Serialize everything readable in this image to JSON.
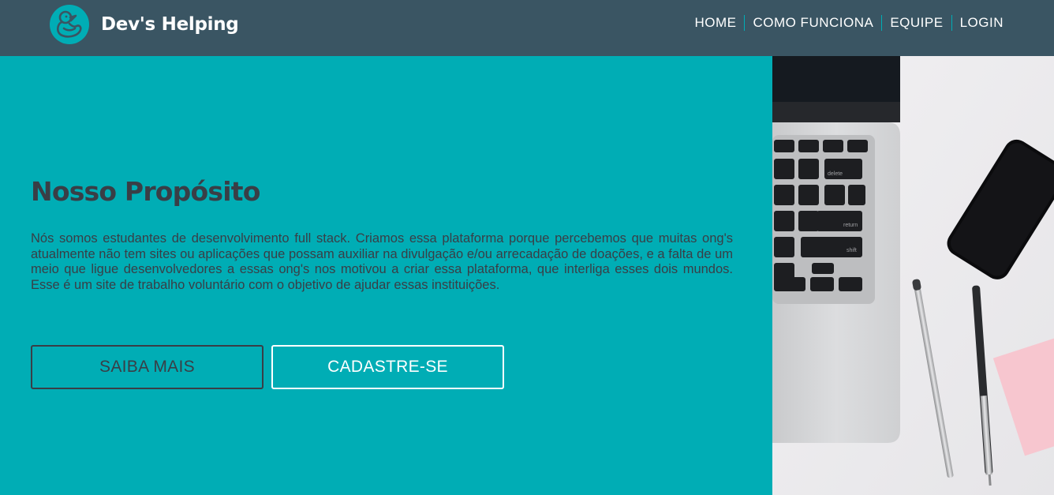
{
  "brand": {
    "name": "Dev's Helping",
    "logo_icon": "duck-icon"
  },
  "nav": {
    "items": [
      "HOME",
      "COMO FUNCIONA",
      "EQUIPE",
      "LOGIN"
    ]
  },
  "hero": {
    "title": "Nosso Propósito",
    "description": "Nós somos estudantes de desenvolvimento full stack. Criamos essa plataforma porque percebemos que muitas ong's atualmente não tem sites ou aplicações que possam auxiliar na divulgação e/ou arrecadação de doações, e a falta de um meio que ligue desenvolvedores a essas ong's nos motivou a criar essa plataforma, que interliga esses dois mundos. Esse é um site de trabalho voluntário com o objetivo de ajudar essas instituições.",
    "buttons": {
      "more": "SAIBA MAIS",
      "signup": "CADASTRE-SE"
    }
  },
  "colors": {
    "navbar": "#3a5563",
    "accent": "#00adb5",
    "text_dark": "#393e46",
    "white": "#ffffff"
  }
}
